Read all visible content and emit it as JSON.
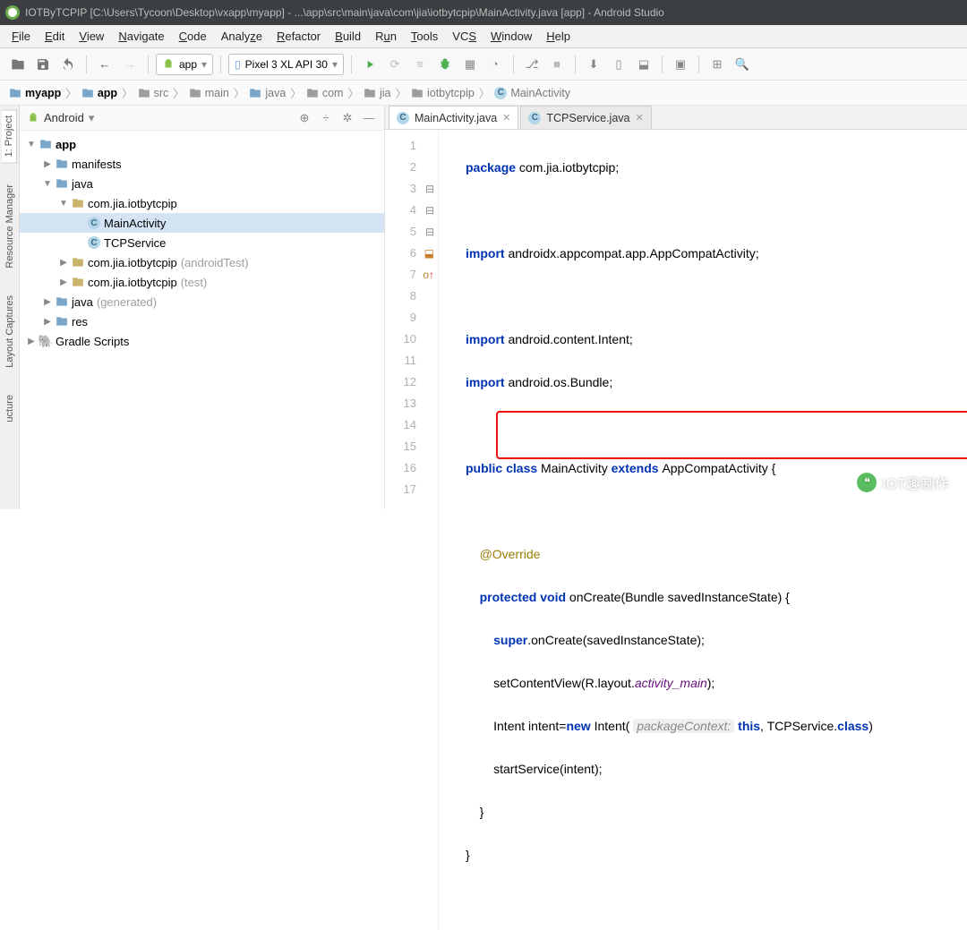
{
  "window": {
    "title": "IOTByTCPIP [C:\\Users\\Tycoon\\Desktop\\vxapp\\myapp] - ...\\app\\src\\main\\java\\com\\jia\\iotbytcpip\\MainActivity.java [app] - Android Studio"
  },
  "menu": [
    "File",
    "Edit",
    "View",
    "Navigate",
    "Code",
    "Analyze",
    "Refactor",
    "Build",
    "Run",
    "Tools",
    "VCS",
    "Window",
    "Help"
  ],
  "toolbar": {
    "config": "app",
    "device": "Pixel 3 XL API 30"
  },
  "breadcrumb": [
    "myapp",
    "app",
    "src",
    "main",
    "java",
    "com",
    "jia",
    "iotbytcpip",
    "MainActivity"
  ],
  "left_rails": [
    "1: Project",
    "Resource Manager",
    "Layout Captures",
    "ucture"
  ],
  "project": {
    "header": "Android",
    "tree": [
      {
        "d": 0,
        "arrow": "▼",
        "icon": "mod",
        "label": "app",
        "bold": true
      },
      {
        "d": 1,
        "arrow": "▶",
        "icon": "folder",
        "label": "manifests"
      },
      {
        "d": 1,
        "arrow": "▼",
        "icon": "folder",
        "label": "java"
      },
      {
        "d": 2,
        "arrow": "▼",
        "icon": "pkg",
        "label": "com.jia.iotbytcpip"
      },
      {
        "d": 3,
        "arrow": "",
        "icon": "class",
        "label": "MainActivity",
        "selected": true
      },
      {
        "d": 3,
        "arrow": "",
        "icon": "class",
        "label": "TCPService"
      },
      {
        "d": 2,
        "arrow": "▶",
        "icon": "pkg",
        "label": "com.jia.iotbytcpip",
        "suffix": "(androidTest)"
      },
      {
        "d": 2,
        "arrow": "▶",
        "icon": "pkg",
        "label": "com.jia.iotbytcpip",
        "suffix": "(test)"
      },
      {
        "d": 1,
        "arrow": "▶",
        "icon": "genfolder",
        "label": "java",
        "suffix": "(generated)"
      },
      {
        "d": 1,
        "arrow": "▶",
        "icon": "resfolder",
        "label": "res"
      },
      {
        "d": 0,
        "arrow": "▶",
        "icon": "gradle",
        "label": "Gradle Scripts"
      }
    ]
  },
  "editor": {
    "tabs": [
      {
        "name": "MainActivity.java",
        "active": true
      },
      {
        "name": "TCPService.java",
        "active": false
      }
    ],
    "lines": 17,
    "code": {
      "l1_a": "package",
      "l1_b": " com.jia.iotbytcpip;",
      "l3_a": "import",
      "l3_b": " androidx.appcompat.app.AppCompatActivity;",
      "l5_a": "import",
      "l5_b": " android.content.Intent;",
      "l6_a": "import",
      "l6_b": " android.os.Bundle;",
      "l8_a": "public class ",
      "l8_b": "MainActivity ",
      "l8_c": "extends ",
      "l8_d": "AppCompatActivity {",
      "l10": "@Override",
      "l11_a": "protected void ",
      "l11_b": "onCreate(Bundle savedInstanceState) {",
      "l12_a": "super",
      "l12_b": ".onCreate(savedInstanceState);",
      "l13_a": "setContentView(R.layout.",
      "l13_b": "activity_main",
      "l13_c": ");",
      "l14_a": "Intent intent=",
      "l14_b": "new ",
      "l14_c": "Intent( ",
      "l14_hint": "packageContext:",
      "l14_d": " this",
      "l14_e": ", TCPService.",
      "l14_f": "class",
      "l14_g": ")",
      "l15": "startService(intent);",
      "l16": "}",
      "l17": "}"
    }
  },
  "watermark": "IOT趣制作"
}
